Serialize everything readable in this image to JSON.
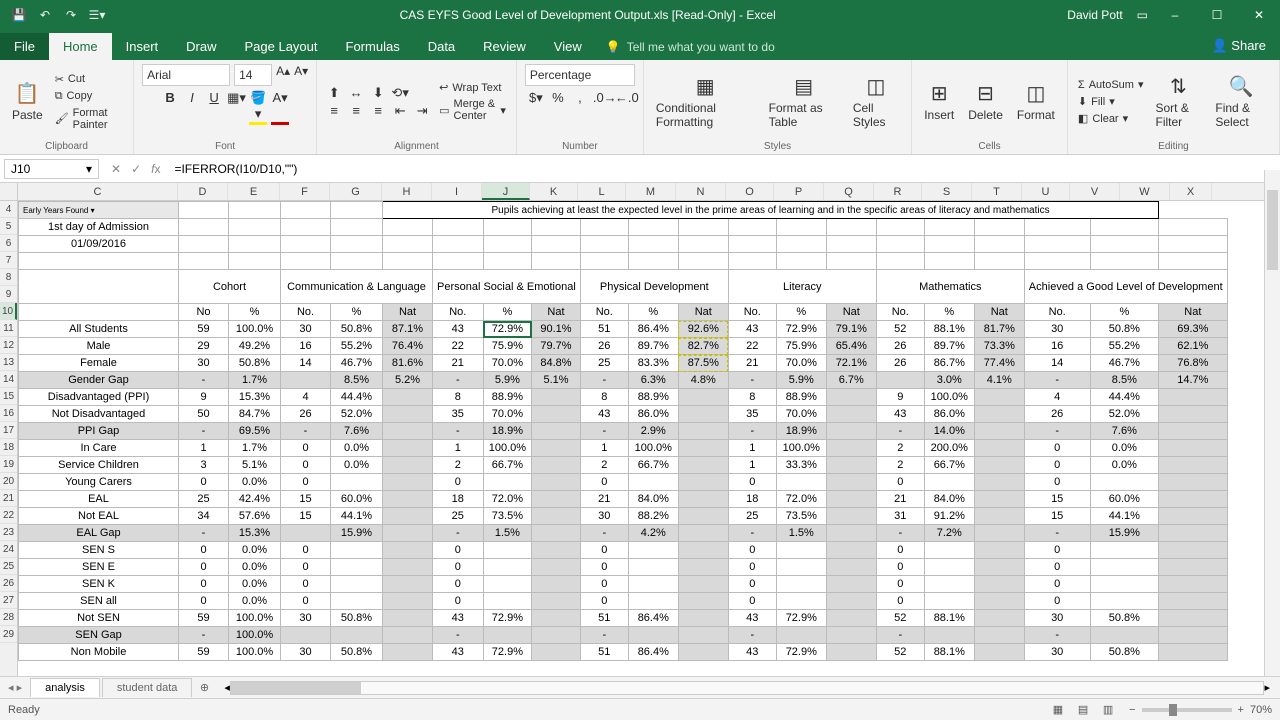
{
  "title": "CAS EYFS Good Level of Development Output.xls  [Read-Only]  -  Excel",
  "user": "David Pott",
  "tabs": {
    "file": "File",
    "home": "Home",
    "insert": "Insert",
    "draw": "Draw",
    "pagelayout": "Page Layout",
    "formulas": "Formulas",
    "data": "Data",
    "review": "Review",
    "view": "View"
  },
  "tellme": "Tell me what you want to do",
  "share": "Share",
  "ribbon": {
    "clipboard": {
      "label": "Clipboard",
      "paste": "Paste",
      "cut": "Cut",
      "copy": "Copy",
      "fmtpaint": "Format Painter"
    },
    "font": {
      "label": "Font",
      "name": "Arial",
      "size": "14"
    },
    "alignment": {
      "label": "Alignment",
      "wrap": "Wrap Text",
      "merge": "Merge & Center"
    },
    "number": {
      "label": "Number",
      "format": "Percentage"
    },
    "styles": {
      "label": "Styles",
      "cond": "Conditional Formatting",
      "table": "Format as Table",
      "cell": "Cell Styles"
    },
    "cells": {
      "label": "Cells",
      "insert": "Insert",
      "delete": "Delete",
      "format": "Format"
    },
    "editing": {
      "label": "Editing",
      "autosum": "AutoSum",
      "fill": "Fill",
      "clear": "Clear",
      "sort": "Sort & Filter",
      "find": "Find & Select"
    }
  },
  "namebox": "J10",
  "formula": "=IFERROR(I10/D10,\"\")",
  "header_note": "Pupils achieving at least the expected level in the prime areas of learning and in the specific areas of literacy and mathematics",
  "admission_label": "1st day of Admission",
  "admission_date": "01/09/2016",
  "eyfs_label": "Early Years Found",
  "col_groups": [
    "Cohort",
    "Communication & Language",
    "Personal Social & Emotional",
    "Physical Development",
    "Literacy",
    "Mathematics",
    "Achieved a Good Level of Development"
  ],
  "subcols": {
    "no": "No",
    "no_dot": "No.",
    "pct": "%",
    "nat": "Nat"
  },
  "rows": [
    {
      "label": "All Students",
      "d": [
        "59",
        "100.0%",
        "30",
        "50.8%",
        "87.1%",
        "43",
        "72.9%",
        "90.1%",
        "51",
        "86.4%",
        "92.6%",
        "43",
        "72.9%",
        "79.1%",
        "52",
        "88.1%",
        "81.7%",
        "30",
        "50.8%",
        "69.3%"
      ],
      "shade": false
    },
    {
      "label": "Male",
      "d": [
        "29",
        "49.2%",
        "16",
        "55.2%",
        "76.4%",
        "22",
        "75.9%",
        "79.7%",
        "26",
        "89.7%",
        "82.7%",
        "22",
        "75.9%",
        "65.4%",
        "26",
        "89.7%",
        "73.3%",
        "16",
        "55.2%",
        "62.1%"
      ],
      "shade": false
    },
    {
      "label": "Female",
      "d": [
        "30",
        "50.8%",
        "14",
        "46.7%",
        "81.6%",
        "21",
        "70.0%",
        "84.8%",
        "25",
        "83.3%",
        "87.5%",
        "21",
        "70.0%",
        "72.1%",
        "26",
        "86.7%",
        "77.4%",
        "14",
        "46.7%",
        "76.8%"
      ],
      "shade": false
    },
    {
      "label": "Gender Gap",
      "d": [
        "-",
        "1.7%",
        "",
        "8.5%",
        "5.2%",
        "-",
        "5.9%",
        "5.1%",
        "-",
        "6.3%",
        "4.8%",
        "-",
        "5.9%",
        "6.7%",
        "",
        "3.0%",
        "4.1%",
        "-",
        "8.5%",
        "14.7%"
      ],
      "shade": true
    },
    {
      "label": "Disadvantaged (PPI)",
      "d": [
        "9",
        "15.3%",
        "4",
        "44.4%",
        "",
        "8",
        "88.9%",
        "",
        "8",
        "88.9%",
        "",
        "8",
        "88.9%",
        "",
        "9",
        "100.0%",
        "",
        "4",
        "44.4%",
        ""
      ],
      "shade": false
    },
    {
      "label": "Not Disadvantaged",
      "d": [
        "50",
        "84.7%",
        "26",
        "52.0%",
        "",
        "35",
        "70.0%",
        "",
        "43",
        "86.0%",
        "",
        "35",
        "70.0%",
        "",
        "43",
        "86.0%",
        "",
        "26",
        "52.0%",
        ""
      ],
      "shade": false
    },
    {
      "label": "PPI Gap",
      "d": [
        "-",
        "69.5%",
        "-",
        "7.6%",
        "",
        "-",
        "18.9%",
        "",
        "-",
        "2.9%",
        "",
        "-",
        "18.9%",
        "",
        "-",
        "14.0%",
        "",
        "-",
        "7.6%",
        ""
      ],
      "shade": true
    },
    {
      "label": "In Care",
      "d": [
        "1",
        "1.7%",
        "0",
        "0.0%",
        "",
        "1",
        "100.0%",
        "",
        "1",
        "100.0%",
        "",
        "1",
        "100.0%",
        "",
        "2",
        "200.0%",
        "",
        "0",
        "0.0%",
        ""
      ],
      "shade": false
    },
    {
      "label": "Service Children",
      "d": [
        "3",
        "5.1%",
        "0",
        "0.0%",
        "",
        "2",
        "66.7%",
        "",
        "2",
        "66.7%",
        "",
        "1",
        "33.3%",
        "",
        "2",
        "66.7%",
        "",
        "0",
        "0.0%",
        ""
      ],
      "shade": false
    },
    {
      "label": "Young Carers",
      "d": [
        "0",
        "0.0%",
        "0",
        "",
        "",
        "0",
        "",
        "",
        "0",
        "",
        "",
        "0",
        "",
        "",
        "0",
        "",
        "",
        "0",
        "",
        ""
      ],
      "shade": false
    },
    {
      "label": "EAL",
      "d": [
        "25",
        "42.4%",
        "15",
        "60.0%",
        "",
        "18",
        "72.0%",
        "",
        "21",
        "84.0%",
        "",
        "18",
        "72.0%",
        "",
        "21",
        "84.0%",
        "",
        "15",
        "60.0%",
        ""
      ],
      "shade": false
    },
    {
      "label": "Not EAL",
      "d": [
        "34",
        "57.6%",
        "15",
        "44.1%",
        "",
        "25",
        "73.5%",
        "",
        "30",
        "88.2%",
        "",
        "25",
        "73.5%",
        "",
        "31",
        "91.2%",
        "",
        "15",
        "44.1%",
        ""
      ],
      "shade": false
    },
    {
      "label": "EAL Gap",
      "d": [
        "-",
        "15.3%",
        "",
        "15.9%",
        "",
        "-",
        "1.5%",
        "",
        "-",
        "4.2%",
        "",
        "-",
        "1.5%",
        "",
        "-",
        "7.2%",
        "",
        "-",
        "15.9%",
        ""
      ],
      "shade": true
    },
    {
      "label": "SEN S",
      "d": [
        "0",
        "0.0%",
        "0",
        "",
        "",
        "0",
        "",
        "",
        "0",
        "",
        "",
        "0",
        "",
        "",
        "0",
        "",
        "",
        "0",
        "",
        ""
      ],
      "shade": false
    },
    {
      "label": "SEN E",
      "d": [
        "0",
        "0.0%",
        "0",
        "",
        "",
        "0",
        "",
        "",
        "0",
        "",
        "",
        "0",
        "",
        "",
        "0",
        "",
        "",
        "0",
        "",
        ""
      ],
      "shade": false
    },
    {
      "label": "SEN K",
      "d": [
        "0",
        "0.0%",
        "0",
        "",
        "",
        "0",
        "",
        "",
        "0",
        "",
        "",
        "0",
        "",
        "",
        "0",
        "",
        "",
        "0",
        "",
        ""
      ],
      "shade": false
    },
    {
      "label": "SEN all",
      "d": [
        "0",
        "0.0%",
        "0",
        "",
        "",
        "0",
        "",
        "",
        "0",
        "",
        "",
        "0",
        "",
        "",
        "0",
        "",
        "",
        "0",
        "",
        ""
      ],
      "shade": false
    },
    {
      "label": "Not SEN",
      "d": [
        "59",
        "100.0%",
        "30",
        "50.8%",
        "",
        "43",
        "72.9%",
        "",
        "51",
        "86.4%",
        "",
        "43",
        "72.9%",
        "",
        "52",
        "88.1%",
        "",
        "30",
        "50.8%",
        ""
      ],
      "shade": false
    },
    {
      "label": "SEN Gap",
      "d": [
        "-",
        "100.0%",
        "",
        "",
        "",
        "-",
        "",
        "",
        "-",
        "",
        "",
        "-",
        "",
        "",
        "-",
        "",
        "",
        "-",
        "",
        ""
      ],
      "shade": true
    },
    {
      "label": "Non Mobile",
      "d": [
        "59",
        "100.0%",
        "30",
        "50.8%",
        "",
        "43",
        "72.9%",
        "",
        "51",
        "86.4%",
        "",
        "43",
        "72.9%",
        "",
        "52",
        "88.1%",
        "",
        "30",
        "50.8%",
        ""
      ],
      "shade": false
    }
  ],
  "sheets": {
    "active": "analysis",
    "other": "student data"
  },
  "status": "Ready",
  "zoom": "70%",
  "rownums": [
    4,
    5,
    6,
    7,
    8,
    9,
    10,
    11,
    12,
    13,
    14,
    15,
    16,
    17,
    18,
    19,
    20,
    21,
    22,
    23,
    24,
    25,
    26,
    27,
    28,
    29
  ],
  "cols": [
    "C",
    "D",
    "E",
    "F",
    "G",
    "H",
    "I",
    "J",
    "K",
    "L",
    "M",
    "N",
    "O",
    "P",
    "Q",
    "R",
    "S",
    "T",
    "U",
    "V",
    "W",
    "X"
  ]
}
